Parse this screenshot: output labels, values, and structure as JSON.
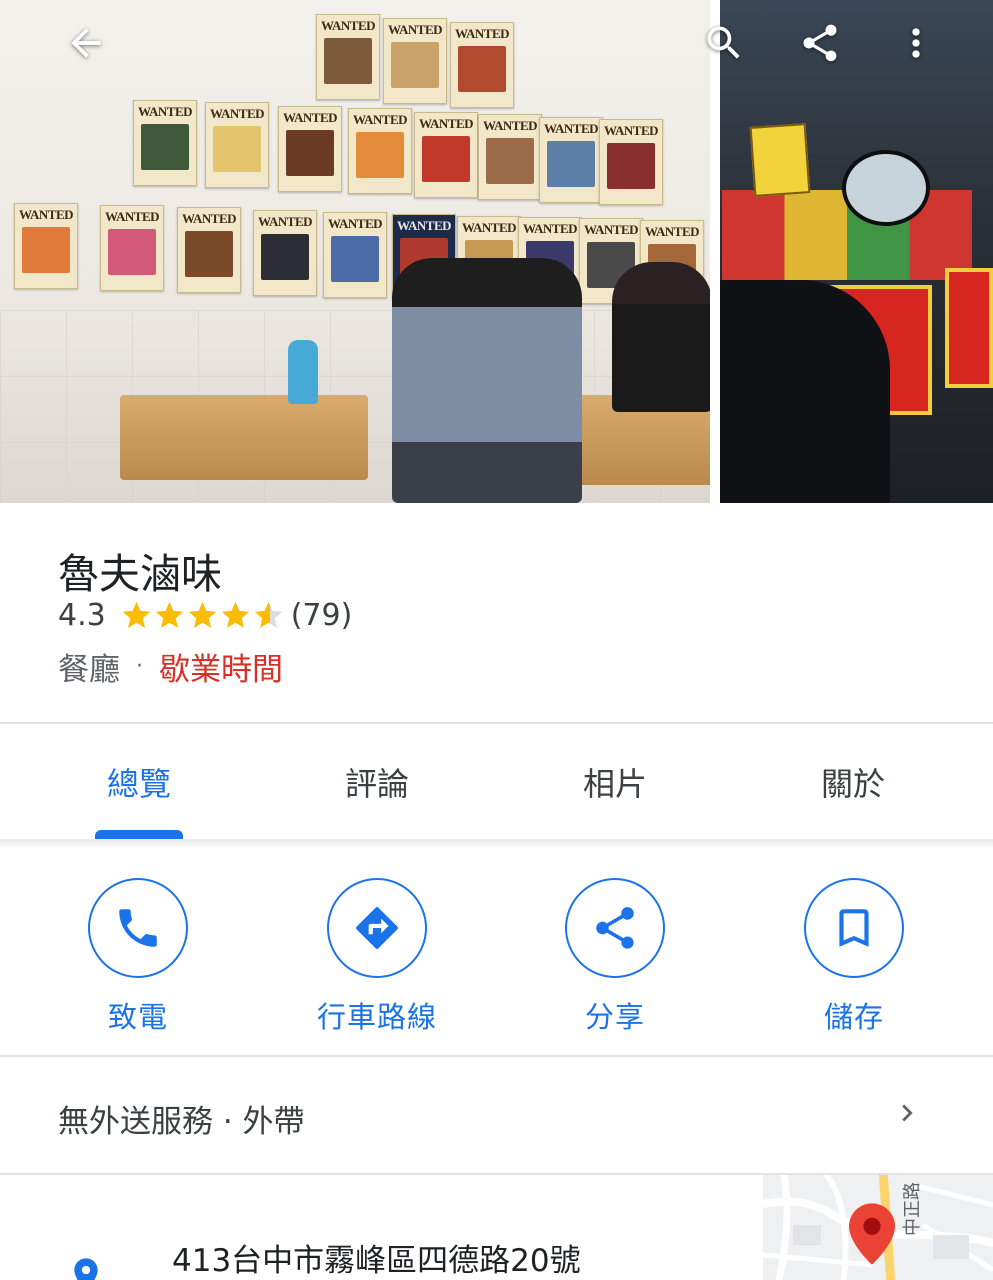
{
  "toolbar": {
    "back_icon": "arrow-left-icon",
    "search_icon": "search-icon",
    "share_icon": "share-icon",
    "more_icon": "more-vert-icon"
  },
  "place": {
    "name": "魯夫滷味",
    "rating": "4.3",
    "rating_value": 4.3,
    "review_count": "(79)",
    "category": "餐廳",
    "separator": "·",
    "hours_label": "歇業時間"
  },
  "tabs": [
    {
      "label": "總覽",
      "active": true
    },
    {
      "label": "評論",
      "active": false
    },
    {
      "label": "相片",
      "active": false
    },
    {
      "label": "關於",
      "active": false
    }
  ],
  "actions": [
    {
      "label": "致電",
      "icon": "phone-icon"
    },
    {
      "label": "行車路線",
      "icon": "directions-icon"
    },
    {
      "label": "分享",
      "icon": "share-icon"
    },
    {
      "label": "儲存",
      "icon": "bookmark-icon"
    }
  ],
  "delivery": {
    "text": "無外送服務 · 外帶"
  },
  "address": {
    "text": "413台中市霧峰區四德路20號",
    "map_road_label": "中正路"
  },
  "colors": {
    "accent": "#1a73e8",
    "closed": "#d93025",
    "star": "#fbbc04",
    "pin": "#ea4335"
  }
}
